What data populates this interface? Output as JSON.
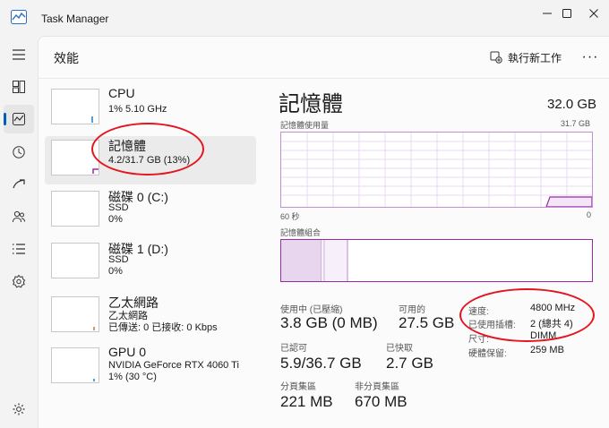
{
  "window": {
    "title": "Task Manager",
    "buttons": {
      "minimize": "—",
      "maximize": "☐",
      "close": "✕"
    }
  },
  "header": {
    "page_title": "效能",
    "run_new_task": "執行新工作",
    "more": "···"
  },
  "nav": {
    "items": [
      "menu-icon",
      "processes-icon",
      "performance-icon",
      "app-history-icon",
      "startup-apps-icon",
      "users-icon",
      "details-icon",
      "services-icon",
      "settings-icon"
    ],
    "active": "performance-icon"
  },
  "sidebar": {
    "cpu": {
      "name": "CPU",
      "line1": "1% 5.10 GHz"
    },
    "memory": {
      "name": "記憶體",
      "line1": "4.2/31.7 GB (13%)"
    },
    "disk0": {
      "name": "磁碟 0 (C:)",
      "line1": "SSD",
      "line2": "0%"
    },
    "disk1": {
      "name": "磁碟 1 (D:)",
      "line1": "SSD",
      "line2": "0%"
    },
    "ethernet": {
      "name": "乙太網路",
      "line1": "乙太網路",
      "line2": "已傳送: 0 已接收: 0 Kbps"
    },
    "gpu": {
      "name": "GPU 0",
      "line1": "NVIDIA GeForce RTX 4060 Ti",
      "line2": "1% (30 °C)"
    }
  },
  "detail": {
    "title": "記憶體",
    "total": "32.0 GB",
    "usage_label": "記憶體使用量",
    "usage_max": "31.7 GB",
    "time_label": "60 秒",
    "time_zero": "0",
    "composition_label": "記憶體組合",
    "usage_fraction": 0.13,
    "stats": {
      "in_use_label": "使用中 (已壓縮)",
      "in_use_value": "3.8 GB (0 MB)",
      "available_label": "可用的",
      "available_value": "27.5 GB",
      "committed_label": "已認可",
      "committed_value": "5.9/36.7 GB",
      "cached_label": "已快取",
      "cached_value": "2.7 GB",
      "paged_label": "分頁集區",
      "paged_value": "221 MB",
      "nonpaged_label": "非分頁集區",
      "nonpaged_value": "670 MB"
    },
    "specs": [
      {
        "label": "速度:",
        "value": "4800 MHz"
      },
      {
        "label": "已使用插槽:",
        "value": "2 (總共 4)"
      },
      {
        "label": "尺寸:",
        "value": "DIMM"
      },
      {
        "label": "硬體保留:",
        "value": "259 MB"
      }
    ]
  },
  "colors": {
    "accent": "#005fb8",
    "memory": "#9a2aa8",
    "annotation": "#e5141e"
  }
}
